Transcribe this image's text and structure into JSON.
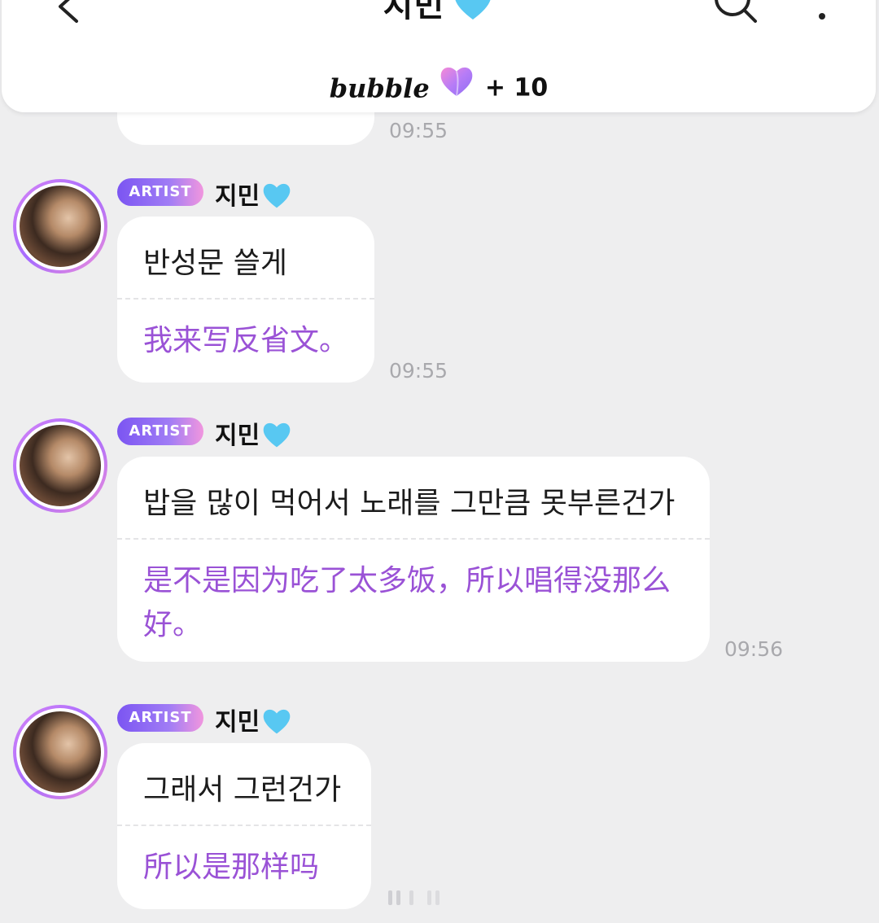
{
  "header": {
    "title": "지민",
    "title_emoji": "light-blue-heart-icon",
    "bubble_logo": "bubble",
    "bubble_count": "+ 10",
    "colors": {
      "accent_purple": "#9a52d6",
      "badge_start": "#7b55f2",
      "badge_end": "#f196de",
      "heart_blue": "#58c8f2"
    }
  },
  "messages": [
    {
      "partial": true,
      "translation": "",
      "time": "09:55"
    },
    {
      "badge": "ARTIST",
      "sender": "지민",
      "text": "반성문 쓸게",
      "translation": "我来写反省文。",
      "time": "09:55"
    },
    {
      "badge": "ARTIST",
      "sender": "지민",
      "text": "밥을 많이 먹어서 노래를 그만큼 못부른건가",
      "translation": "是不是因为吃了太多饭，所以唱得没那么好。",
      "time": "09:56"
    },
    {
      "badge": "ARTIST",
      "sender": "지민",
      "text": "그래서 그런건가",
      "translation": "所以是那样吗",
      "time": ""
    }
  ]
}
